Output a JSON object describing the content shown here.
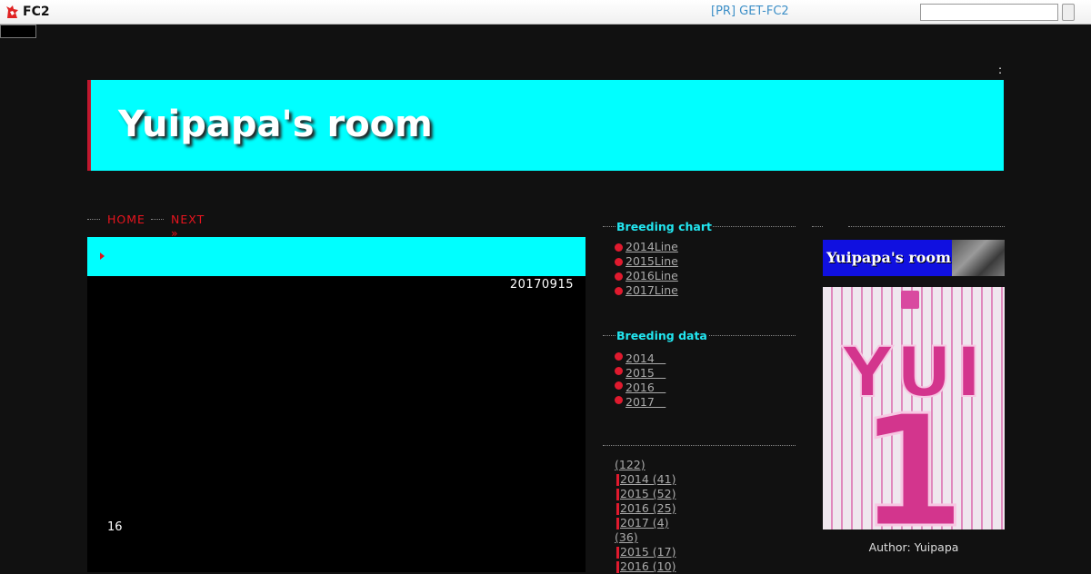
{
  "topbar": {
    "logo": "FC2",
    "pr_link": "[PR] GET-FC2",
    "search_placeholder": ""
  },
  "misc": {
    "colon": ":"
  },
  "header": {
    "title": "Yuipapa's room"
  },
  "nav": {
    "home": "HOME",
    "next": "NEXT »"
  },
  "entry": {
    "date": "20170915",
    "number": "16"
  },
  "sidebar": {
    "breeding_chart": {
      "title": "Breeding chart",
      "items": [
        "2014Line",
        "2015Line",
        "2016Line",
        "2017Line"
      ]
    },
    "breeding_data": {
      "title": "Breeding data",
      "items": [
        "2014　",
        "2015　",
        "2016　",
        "2017　"
      ]
    },
    "archives": [
      {
        "label": "(122)",
        "child": false
      },
      {
        "label": "2014 (41)",
        "child": true
      },
      {
        "label": "2015 (52)",
        "child": true
      },
      {
        "label": "2016 (25)",
        "child": true
      },
      {
        "label": "2017 (4)",
        "child": true
      },
      {
        "label": "(36)",
        "child": false
      },
      {
        "label": "2015 (17)",
        "child": true
      },
      {
        "label": "2016 (10)",
        "child": true
      }
    ]
  },
  "profile": {
    "banner_text": "Yuipapa's room",
    "jersey_name": "YUI",
    "jersey_number": "1",
    "author": "Author: Yuipapa"
  },
  "colors": {
    "accent_cyan": "#00ffff",
    "accent_red": "#e01a2e",
    "sidebar_title": "#22e6f0",
    "background": "#111111"
  }
}
